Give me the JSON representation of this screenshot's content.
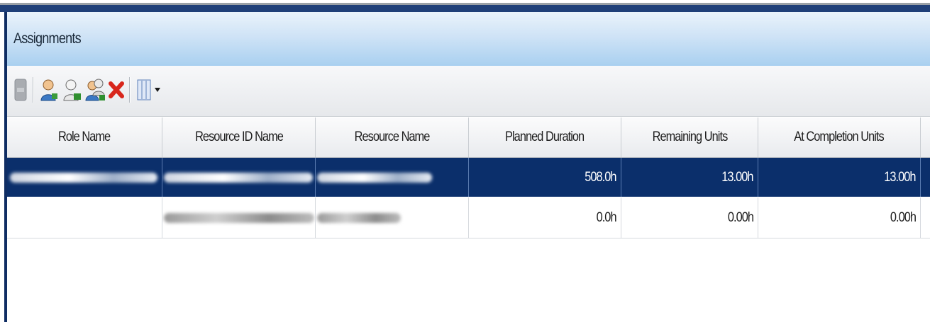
{
  "panel": {
    "title": "Assignments"
  },
  "toolbar": {
    "buttons": [
      {
        "name": "disabled-action-icon"
      },
      {
        "name": "assign-resource-icon"
      },
      {
        "name": "assign-role-icon"
      },
      {
        "name": "assign-resource-by-role-icon"
      },
      {
        "name": "delete-icon"
      },
      {
        "name": "columns-icon"
      }
    ]
  },
  "table": {
    "columns": [
      "Role Name",
      "Resource ID Name",
      "Resource Name",
      "Planned Duration",
      "Remaining Units",
      "At Completion Units"
    ],
    "rows": [
      {
        "selected": true,
        "role_name": "",
        "resource_id_name": "",
        "resource_name": "",
        "planned_duration": "508.0h",
        "remaining_units": "13.00h",
        "at_completion_units": "13.00h"
      },
      {
        "selected": false,
        "role_name": "",
        "resource_id_name": "",
        "resource_name": "",
        "planned_duration": "0.0h",
        "remaining_units": "0.00h",
        "at_completion_units": "0.00h"
      }
    ]
  },
  "colors": {
    "selected_row": "#0b2f6b",
    "header_gradient_bottom": "#a9d0f0",
    "frame_border": "#1f3f78",
    "delete_red": "#d8261c"
  }
}
